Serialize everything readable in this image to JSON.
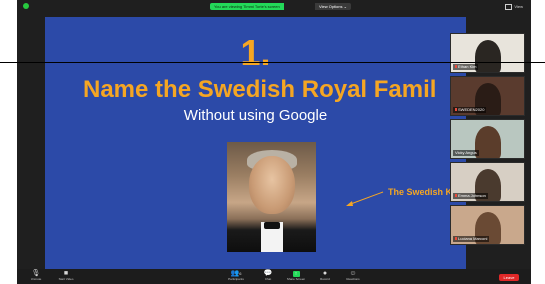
{
  "share_bar": {
    "sharing_text": "You are viewing Timmi Torte's screen",
    "view_options": "View Options ⌄",
    "view_toggle": "View"
  },
  "slide": {
    "number": "1.",
    "title": "Name the Swedish Royal Famil",
    "subtitle": "Without using Google",
    "king_label": "The Swedish King"
  },
  "participants": [
    {
      "name": "Ethan Kim",
      "bg": "#e8e4dc",
      "person": "#2a2622"
    },
    {
      "name": "SWEDEN2020",
      "bg": "#5a3b2e",
      "person": "#2a1c16"
    },
    {
      "name": "Vicky Angus",
      "bg": "#b9c7c0",
      "person": "#5b3d2b"
    },
    {
      "name": "Emma Johnson",
      "bg": "#d7cfc4",
      "person": "#4a3a2e"
    },
    {
      "name": "Luciana Marconi",
      "bg": "#c9a88c",
      "person": "#6a4a34"
    }
  ],
  "toolbar": {
    "unmute": "Unmute",
    "start_video": "Start Video",
    "participants": "Participants",
    "participants_count": "6",
    "chat": "Chat",
    "share_screen": "Share Screen",
    "record": "Record",
    "reactions": "Reactions",
    "leave": "Leave"
  },
  "colors": {
    "slide_bg": "#2c4aa8",
    "accent": "#f5a623",
    "share_green": "#23d959",
    "leave_red": "#e02828"
  }
}
